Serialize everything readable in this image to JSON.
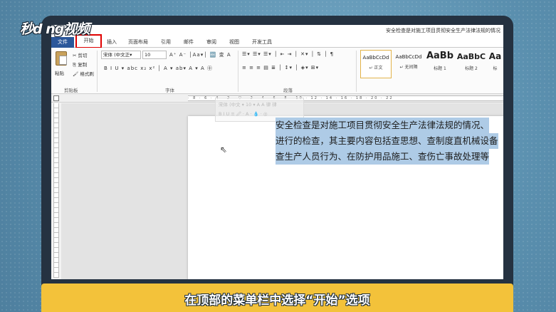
{
  "watermark": "秒d ng视频",
  "window": {
    "title": "安全检查是对施工项目贯彻安全生产法律法规的情况"
  },
  "tabs": [
    {
      "label": "文件"
    },
    {
      "label": "开始"
    },
    {
      "label": "插入"
    },
    {
      "label": "页面布局"
    },
    {
      "label": "引用"
    },
    {
      "label": "邮件"
    },
    {
      "label": "审阅"
    },
    {
      "label": "视图"
    },
    {
      "label": "开发工具"
    }
  ],
  "ribbon": {
    "clipboard": {
      "paste": "粘贴",
      "cut": "剪切",
      "copy": "复制",
      "format_painter": "格式刷",
      "label": "剪贴板"
    },
    "font": {
      "font_name": "宋体 (中文正▾",
      "font_size": "10",
      "label": "字体"
    },
    "paragraph": {
      "label": "段落"
    },
    "styles": [
      {
        "sample": "AaBbCcDd",
        "name": "↵ 正文"
      },
      {
        "sample": "AaBbCcDd",
        "name": "↵ 无间隔"
      },
      {
        "sample": "AaBb",
        "name": "标题 1"
      },
      {
        "sample": "AaBbC",
        "name": "标题 2"
      },
      {
        "sample": "Aa",
        "name": "标"
      }
    ]
  },
  "mini_toolbar": {
    "font": "宋体 (中文 ▾ 10 ▾ A A 律 律",
    "row2": "B I U ≡ 🖉 · A · 💧 · ◎"
  },
  "document": {
    "lines": [
      "安全检查是对施工项目贯彻安全生产法律法规的情况、",
      "进行的检查，其主要内容包括查思想、查制度直机械设备",
      "查生产人员行为、在防护用品施工、查伤亡事故处理等"
    ]
  },
  "caption": "在顶部的菜单栏中选择“开始”选项",
  "colors": {
    "file_tab": "#2b579a",
    "highlight_box": "#e00000",
    "selection": "#aecbe6",
    "caption_bar": "#f3c23a"
  }
}
